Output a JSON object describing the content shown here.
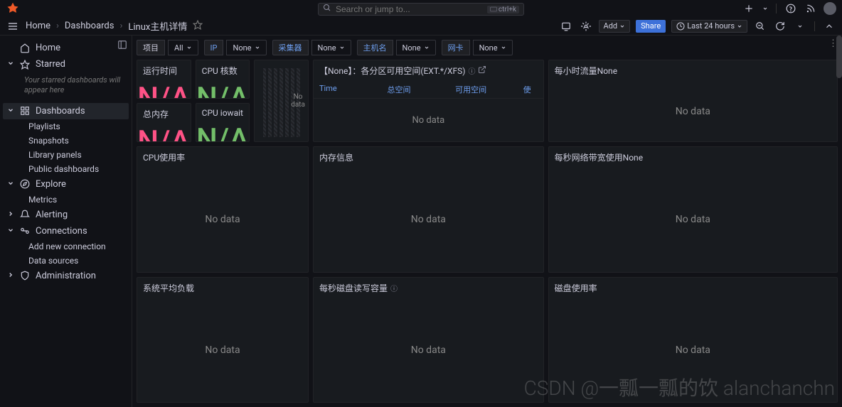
{
  "search": {
    "placeholder": "Search or jump to...",
    "hint": "ctrl+k"
  },
  "breadcrumb": {
    "home": "Home",
    "dashboards": "Dashboards",
    "current": "Linux主机详情"
  },
  "toolbar": {
    "add": "Add",
    "share": "Share",
    "time_range": "Last 24 hours"
  },
  "sidebar": {
    "home": "Home",
    "starred": "Starred",
    "starred_hint": "Your starred dashboards will appear here",
    "dashboards": "Dashboards",
    "playlists": "Playlists",
    "snapshots": "Snapshots",
    "library": "Library panels",
    "public": "Public dashboards",
    "explore": "Explore",
    "metrics": "Metrics",
    "alerting": "Alerting",
    "connections": "Connections",
    "add_conn": "Add new connection",
    "data_sources": "Data sources",
    "admin": "Administration"
  },
  "vars": {
    "project_label": "项目",
    "project_value": "All",
    "ip_label": "IP",
    "ip_value": "None",
    "collector_label": "采集器",
    "collector_value": "None",
    "host_label": "主机名",
    "host_value": "None",
    "nic_label": "网卡",
    "nic_value": "None"
  },
  "panels": {
    "runtime": "运行时间",
    "cores": "CPU 核数",
    "mem": "总内存",
    "iowait": "CPU iowait",
    "partitions": "【None】：各分区可用空间(EXT.*/XFS)",
    "partitions_cols": {
      "time": "Time",
      "total": "总空间",
      "avail": "可用空间",
      "use": "使"
    },
    "traffic": "每小时流量None",
    "cpu": "CPU使用率",
    "meminfo": "内存信息",
    "net": "每秒网络带宽使用None",
    "load": "系统平均负载",
    "disk": "每秒磁盘读写容量",
    "diskuse": "磁盘使用率",
    "na": "N/A",
    "nodata": "No data",
    "nodata_short": "No\ndata"
  },
  "watermark": "CSDN @一瓢一瓢的饮 alanchanchn"
}
